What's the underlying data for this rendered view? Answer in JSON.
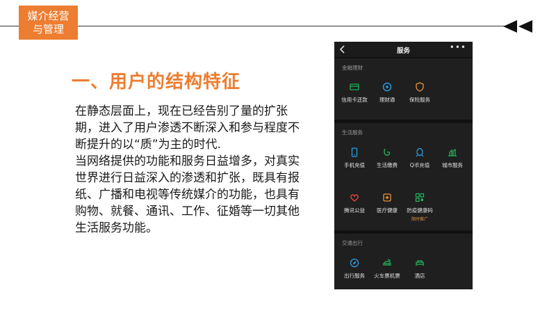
{
  "header": {
    "badge_line1": "媒介经营",
    "badge_line2": "与管理"
  },
  "main": {
    "title": "一、用户的结构特征",
    "paragraphs": [
      "在静态层面上，现在已经告别了量的扩张期，进入了用户渗透不断深入和参与程度不断提升的以“质”为主的时代.",
      "当网络提供的功能和服务日益增多，对真实世界进行日益深入的渗透和扩张，既具有报纸、广播和电视等传统媒介的功能，也具有购物、就餐、通讯、工作、征婚等一切其他生活服务功能。"
    ]
  },
  "phone": {
    "title": "服务",
    "more": "•••",
    "sections": [
      {
        "title": "金融理财",
        "items": [
          {
            "label": "信用卡还款",
            "icon": "credit-card-icon"
          },
          {
            "label": "理财通",
            "icon": "wealth-icon"
          },
          {
            "label": "保险服务",
            "icon": "insurance-icon"
          }
        ]
      },
      {
        "title": "生活服务",
        "items": [
          {
            "label": "手机充值",
            "icon": "mobile-topup-icon"
          },
          {
            "label": "生活缴费",
            "icon": "utility-bill-icon"
          },
          {
            "label": "Q币充值",
            "icon": "qq-coin-icon"
          },
          {
            "label": "城市服务",
            "icon": "city-service-icon"
          },
          {
            "label": "腾讯公益",
            "icon": "charity-icon"
          },
          {
            "label": "医疗健康",
            "icon": "medical-icon"
          },
          {
            "label": "防疫健康码",
            "icon": "health-code-icon",
            "tag": "限时推广"
          }
        ]
      },
      {
        "title": "交通出行",
        "items": [
          {
            "label": "出行服务",
            "icon": "travel-icon"
          },
          {
            "label": "火车票机票",
            "icon": "train-ticket-icon"
          },
          {
            "label": "酒店",
            "icon": "hotel-icon"
          }
        ]
      }
    ]
  },
  "colors": {
    "accent": "#ed7d31",
    "phone_bg": "#111111",
    "green_icon": "#22b35a",
    "blue_icon": "#2aa0e8",
    "orange_icon": "#e8943a",
    "red_icon": "#e6453c"
  }
}
